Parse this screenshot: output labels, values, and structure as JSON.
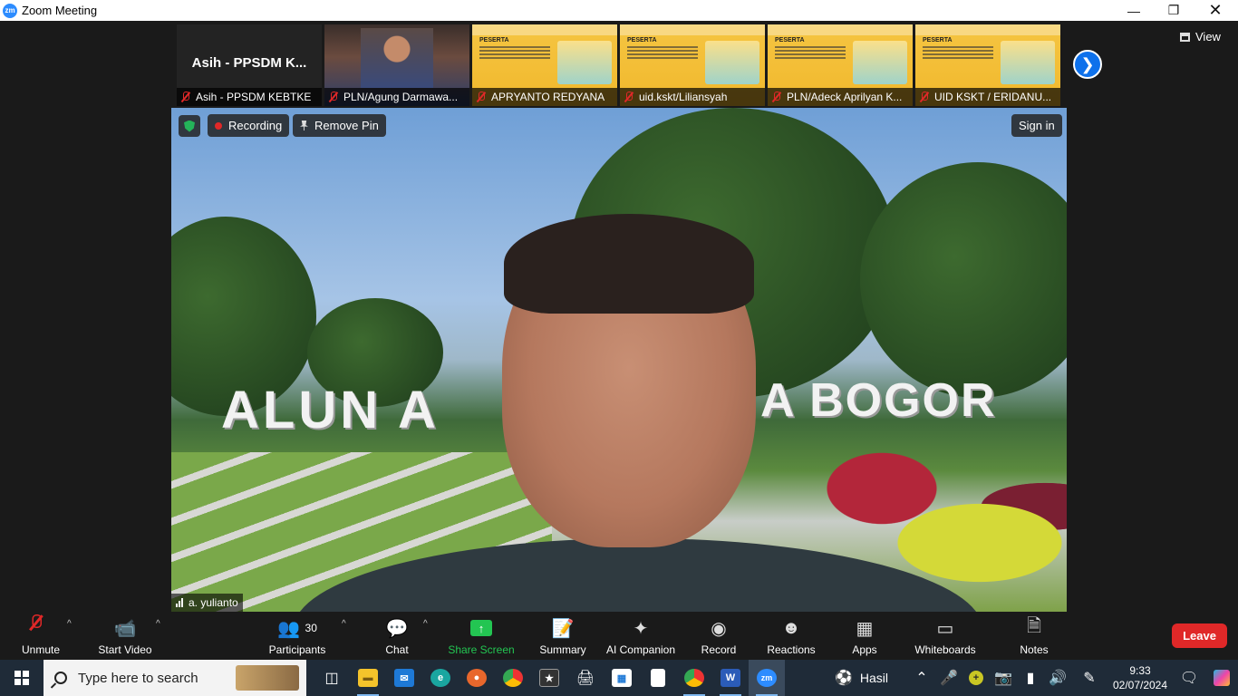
{
  "window": {
    "title": "Zoom Meeting",
    "logo": "zm"
  },
  "thumbnails": [
    {
      "type": "name",
      "big_name": "Asih - PPSDM K...",
      "label": "Asih - PPSDM KEBTKE"
    },
    {
      "type": "video",
      "label": "PLN/Agung Darmawa..."
    },
    {
      "type": "slide",
      "label": "APRYANTO REDYANA",
      "slide_title": "PESERTA"
    },
    {
      "type": "slide",
      "label": "uid.kskt/Liliansyah",
      "slide_title": "PESERTA"
    },
    {
      "type": "slide",
      "label": "PLN/Adeck Aprilyan K...",
      "slide_title": "PESERTA"
    },
    {
      "type": "slide",
      "label": "UID KSKT / ERIDANU...",
      "slide_title": "PESERTA"
    }
  ],
  "view_label": "View",
  "main_video": {
    "recording_label": "Recording",
    "remove_pin_label": "Remove Pin",
    "sign_in_label": "Sign in",
    "participant_name": "a. yulianto",
    "background_text_left": "ALUN A",
    "background_text_right": "A BOGOR"
  },
  "toolbar": {
    "unmute": "Unmute",
    "start_video": "Start Video",
    "participants": "Participants",
    "participants_count": "30",
    "chat": "Chat",
    "share_screen": "Share Screen",
    "summary": "Summary",
    "ai_companion": "AI Companion",
    "record": "Record",
    "reactions": "Reactions",
    "apps": "Apps",
    "whiteboards": "Whiteboards",
    "notes": "Notes",
    "leave": "Leave"
  },
  "taskbar": {
    "search_placeholder": "Type here to search",
    "weather_label": "Hasil",
    "time": "9:33",
    "date": "02/07/2024",
    "zoom_icon_text": "zm",
    "word_icon_text": "W"
  },
  "colors": {
    "accent": "#0e71eb",
    "leave": "#e02828",
    "share": "#23c552"
  }
}
